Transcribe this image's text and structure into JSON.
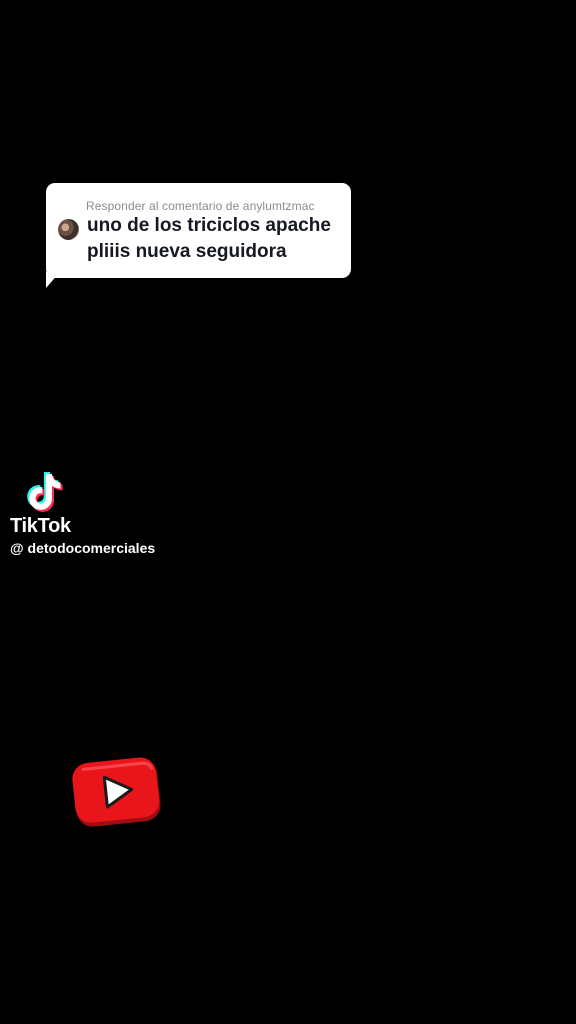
{
  "reply": {
    "header": "Responder al comentario de anylumtzmac",
    "line1": "uno de los triciclos apache",
    "line2": "pliiis nueva seguidora"
  },
  "watermark": {
    "brand": "TikTok",
    "handle": "@ detodocomerciales",
    "logo_icon": "tiktok-note-icon"
  },
  "sticker": {
    "icon": "youtube-play-icon",
    "color": "#e8161b"
  },
  "colors": {
    "background": "#000000",
    "bubble": "#ffffff",
    "bubble_text": "#161823",
    "bubble_header": "#8a8b91",
    "tiktok_cyan": "#25f4ee",
    "tiktok_red": "#fe2c55"
  }
}
